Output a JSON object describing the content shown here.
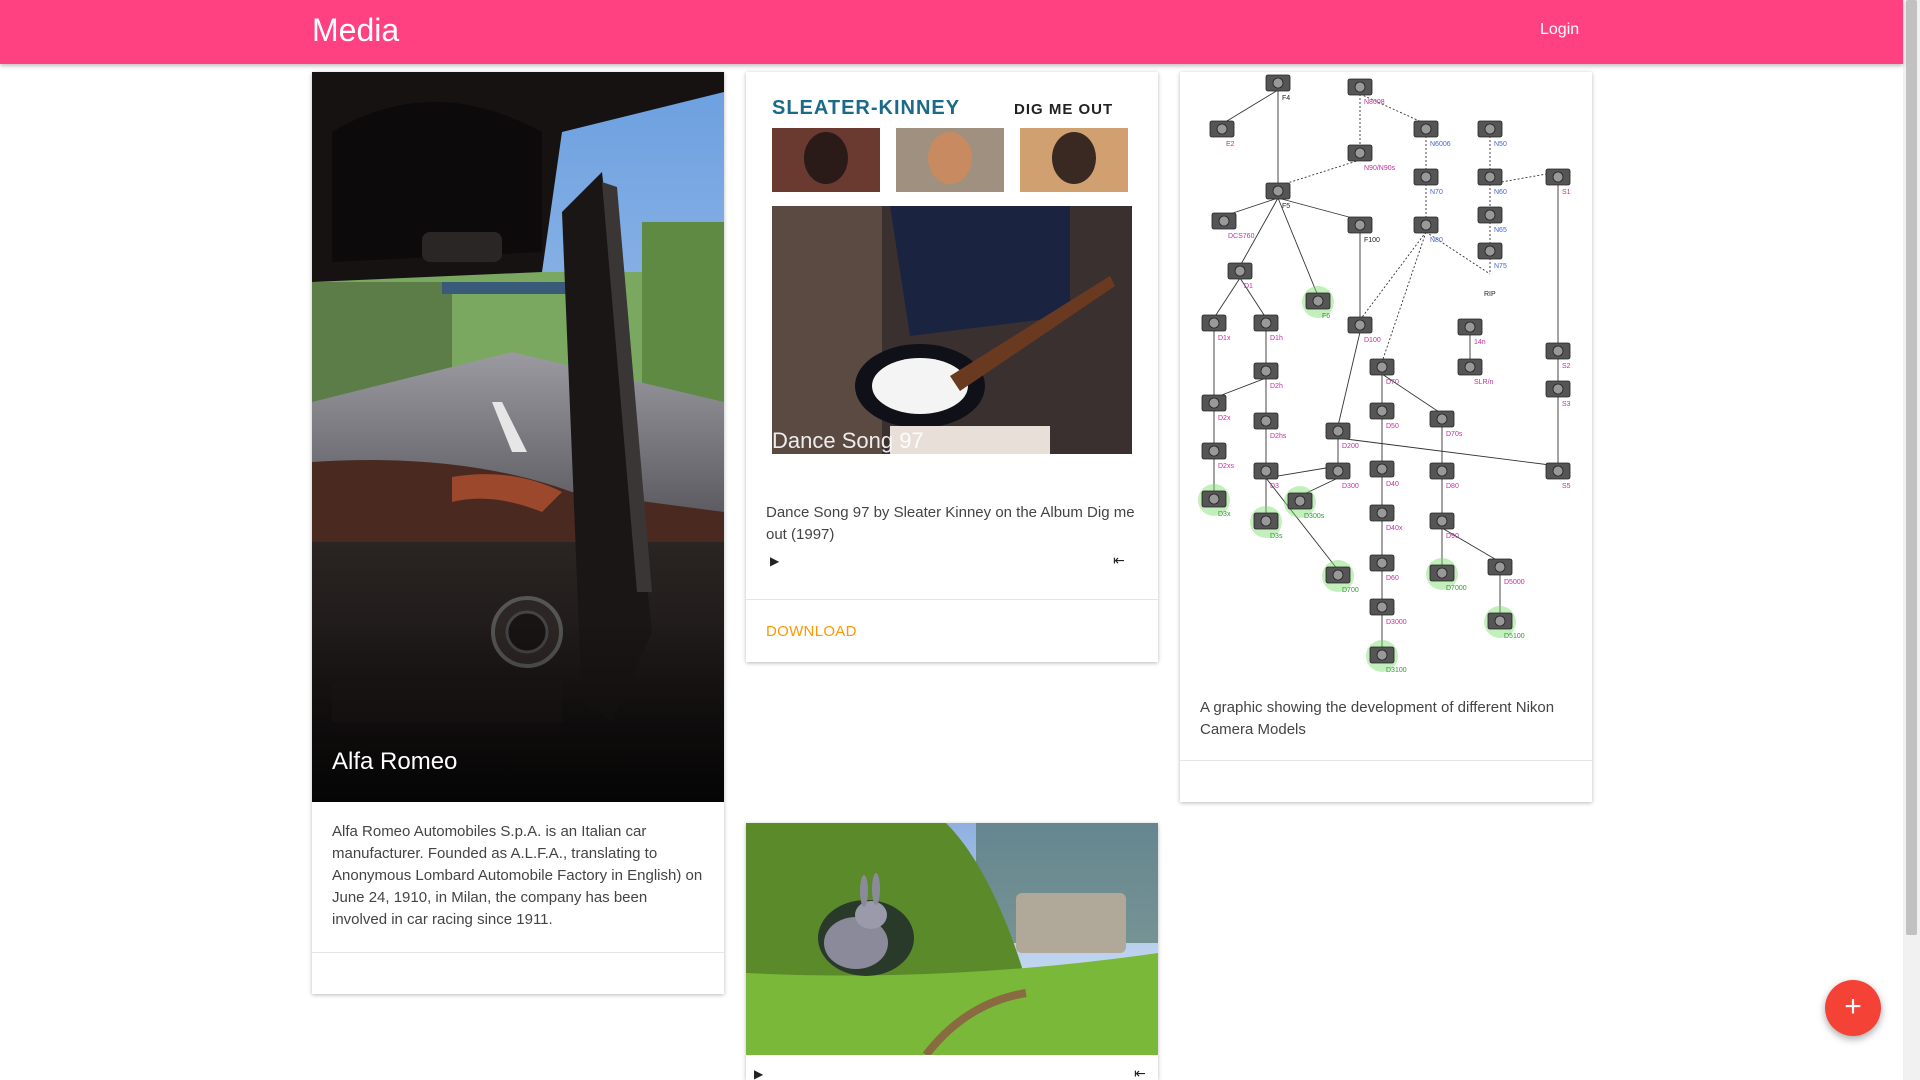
{
  "header": {
    "title": "Media",
    "login_label": "Login",
    "color": "#ff4081"
  },
  "cards": [
    {
      "caption": "Alfa Romeo",
      "description": "Alfa Romeo Automobiles S.p.A. is an Italian car manufacturer. Founded as A.L.F.A., translating to Anonymous Lombard Automobile Factory in English) on June 24, 1910, in Milan, the company has been involved in car racing since 1911."
    },
    {
      "cover_band": "SLEATER-KINNEY",
      "cover_album": "DIG ME OUT",
      "cover_caption": "Dance Song 97",
      "description": "Dance Song 97 by Sleater Kinney on the Album Dig me out (1997)",
      "play_icon": "▶",
      "skip_icon": "⇤",
      "download_label": "DOWNLOAD",
      "accent": "#ff9800"
    },
    {
      "description": "A graphic showing the development of different Nikon Camera Models",
      "models": [
        "F4",
        "N8008",
        "E2",
        "N90/N90s",
        "N6006",
        "N50",
        "F5",
        "N70",
        "N60",
        "S1",
        "DCS760",
        "F100",
        "N80",
        "N65",
        "N75",
        "RIP",
        "D1",
        "F6",
        "D100",
        "D1x",
        "D1h",
        "14n",
        "S2",
        "D2h",
        "D70",
        "SLR/n",
        "S3",
        "D2x",
        "D50",
        "D2hs",
        "D200",
        "D70s",
        "D2xs",
        "D40",
        "D80",
        "S5",
        "D3",
        "D300",
        "D300s",
        "D3x",
        "D3s",
        "D40x",
        "D90",
        "D5000",
        "D700",
        "D60",
        "D7000",
        "D3000",
        "D5100",
        "D3100"
      ]
    },
    {
      "play_icon": "▶",
      "skip_icon": "⇤"
    }
  ],
  "fab": {
    "icon": "+",
    "color": "#f44336"
  }
}
